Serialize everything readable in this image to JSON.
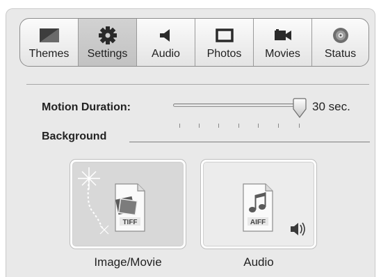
{
  "toolbar": {
    "tabs": [
      {
        "label": "Themes",
        "icon": "themes-icon"
      },
      {
        "label": "Settings",
        "icon": "gear-icon",
        "selected": true
      },
      {
        "label": "Audio",
        "icon": "speaker-icon"
      },
      {
        "label": "Photos",
        "icon": "photo-frame-icon"
      },
      {
        "label": "Movies",
        "icon": "movie-camera-icon"
      },
      {
        "label": "Status",
        "icon": "disc-icon"
      }
    ]
  },
  "settings": {
    "motion_duration_label": "Motion Duration:",
    "motion_duration_value": "30 sec.",
    "motion_duration_slider_fraction": 1.0,
    "background_label": "Background"
  },
  "wells": {
    "image": {
      "caption": "Image/Movie",
      "file_badge": "TIFF"
    },
    "audio": {
      "caption": "Audio",
      "file_badge": "AIFF"
    }
  }
}
